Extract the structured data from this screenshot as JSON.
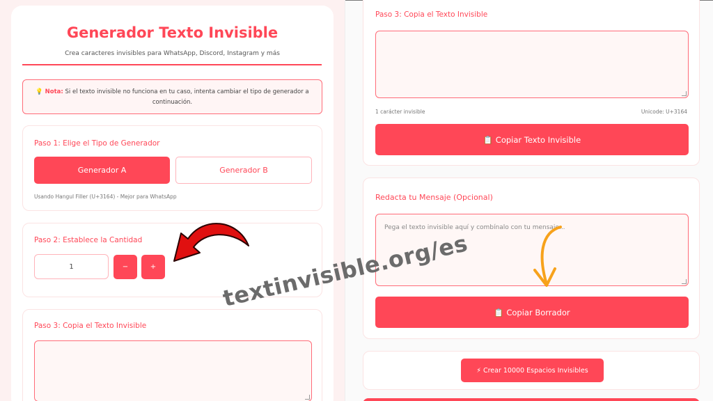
{
  "header": {
    "title": "Generador Texto Invisible",
    "subtitle": "Crea caracteres invisibles para WhatsApp, Discord, Instagram y más"
  },
  "note": {
    "icon": "lightbulb-icon",
    "label": "Nota:",
    "text": "Si el texto invisible no funciona en tu caso, intenta cambiar el tipo de generador a continuación."
  },
  "step1": {
    "label": "Paso 1: Elige el Tipo de Generador",
    "option_a": "Generador A",
    "option_b": "Generador B",
    "hint": "Usando Hangul Filler (U+3164) - Mejor para WhatsApp"
  },
  "step2": {
    "label": "Paso 2: Establece la Cantidad",
    "quantity": "1",
    "minus": "−",
    "plus": "+"
  },
  "step3": {
    "label": "Paso 3: Copia el Texto Invisible",
    "count_text": "1 carácter invisible",
    "unicode_text": "Unicode: U+3164",
    "copy_button": "📋 Copiar Texto Invisible"
  },
  "compose": {
    "label": "Redacta tu Mensaje (Opcional)",
    "placeholder": "Pega el texto invisible aquí y combínalo con tu mensaje...",
    "copy_button": "📋 Copiar Borrador"
  },
  "spaces": {
    "button": "⚡ Crear 10000 Espacios Invisibles"
  },
  "watermark": "textinvisible.org/es",
  "colors": {
    "accent": "#ff4757",
    "arrow_red": "#e01010",
    "arrow_orange": "#f7a21b"
  }
}
